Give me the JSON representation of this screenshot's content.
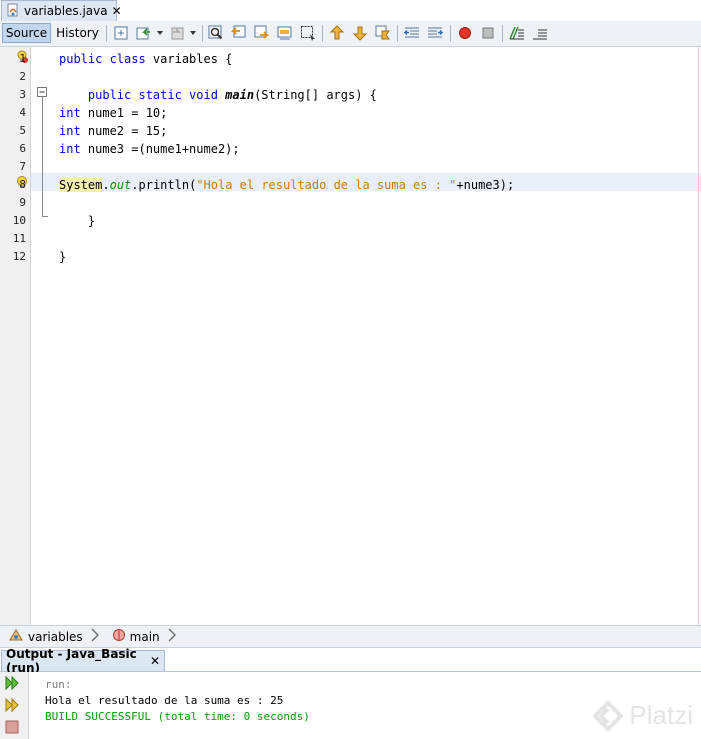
{
  "file_tab": {
    "label": "variables.java",
    "close": "✕"
  },
  "toolbar": {
    "source_label": "Source",
    "history_label": "History"
  },
  "editor": {
    "lines": [
      {
        "n": "1",
        "parts": [
          {
            "t": "public class ",
            "c": "kw"
          },
          {
            "t": "variables {",
            "c": ""
          }
        ]
      },
      {
        "n": "2",
        "parts": []
      },
      {
        "n": "3",
        "parts": [
          {
            "t": "    public static void ",
            "c": "kw"
          },
          {
            "t": "main",
            "c": "bold-it"
          },
          {
            "t": "(String[] args) {",
            "c": ""
          }
        ]
      },
      {
        "n": "4",
        "parts": [
          {
            "t": "int",
            "c": "kw"
          },
          {
            "t": " nume1 = 10;",
            "c": ""
          }
        ]
      },
      {
        "n": "5",
        "parts": [
          {
            "t": "int",
            "c": "kw"
          },
          {
            "t": " nume2 = 15;",
            "c": ""
          }
        ]
      },
      {
        "n": "6",
        "parts": [
          {
            "t": "int",
            "c": "kw"
          },
          {
            "t": " nume3 =(nume1+nume2);",
            "c": ""
          }
        ]
      },
      {
        "n": "7",
        "parts": []
      },
      {
        "n": "8",
        "parts": [
          {
            "t": "System",
            "c": "sys"
          },
          {
            "t": ".",
            "c": ""
          },
          {
            "t": "out",
            "c": "fld"
          },
          {
            "t": ".println(",
            "c": ""
          },
          {
            "t": "\"Hola el resultado de la suma es : \"",
            "c": "str"
          },
          {
            "t": "+nume3);",
            "c": ""
          }
        ]
      },
      {
        "n": "9",
        "parts": []
      },
      {
        "n": "10",
        "parts": [
          {
            "t": "    }",
            "c": ""
          }
        ]
      },
      {
        "n": "11",
        "parts": []
      },
      {
        "n": "12",
        "parts": [
          {
            "t": "}",
            "c": ""
          }
        ]
      }
    ]
  },
  "breadcrumb": {
    "class_label": "variables",
    "method_label": "main"
  },
  "output": {
    "tab_label": "Output - Java_Basic (run)",
    "close": "✕",
    "lines": [
      {
        "text": "run:",
        "color": "#808080"
      },
      {
        "text": "Hola el resultado de la suma es : 25",
        "color": "#000000"
      },
      {
        "text": "BUILD SUCCESSFUL (total time: 0 seconds)",
        "color": "#009900"
      }
    ]
  },
  "watermark": "Platzi"
}
